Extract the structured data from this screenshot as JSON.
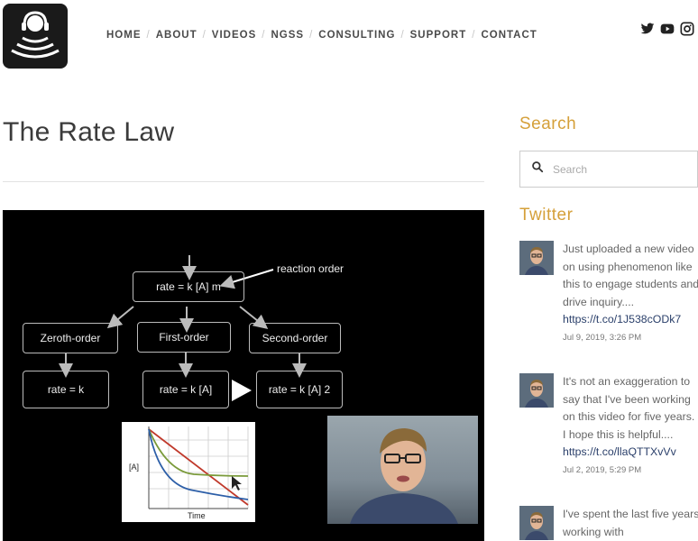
{
  "nav": {
    "items": [
      "HOME",
      "ABOUT",
      "VIDEOS",
      "NGSS",
      "CONSULTING",
      "SUPPORT",
      "CONTACT"
    ]
  },
  "social": [
    "twitter-icon",
    "youtube-icon",
    "instagram-icon"
  ],
  "page": {
    "title": "The Rate Law"
  },
  "video": {
    "top_box": "rate = k [A] m",
    "annotation": "reaction order",
    "orders": [
      "Zeroth-order",
      "First-order",
      "Second-order"
    ],
    "laws": [
      "rate = k",
      "rate = k [A]",
      "rate = k [A] 2"
    ],
    "graph_ylabel": "[A]",
    "graph_xlabel": "Time"
  },
  "sidebar": {
    "search_heading": "Search",
    "search_placeholder": "Search",
    "twitter_heading": "Twitter",
    "tweets": [
      {
        "text": "Just uploaded a new video on using phenomenon like this to engage students and drive inquiry....",
        "link": "https://t.co/1J538cODk7",
        "date": "Jul 9, 2019, 3:26 PM"
      },
      {
        "text": "It's not an exaggeration to say that I've been working on this video for five years. I hope this is helpful....",
        "link": "https://t.co/llaQTTXvVv",
        "date": "Jul 2, 2019, 5:29 PM"
      },
      {
        "text": "I've spent the last five years working with"
      }
    ]
  }
}
